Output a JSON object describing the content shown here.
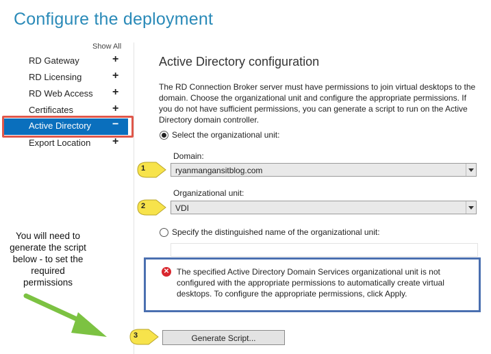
{
  "page": {
    "title": "Configure the deployment"
  },
  "nav": {
    "show_all": "Show All",
    "items": [
      {
        "label": "RD Gateway",
        "sign": "+"
      },
      {
        "label": "RD Licensing",
        "sign": "+"
      },
      {
        "label": "RD Web Access",
        "sign": "+"
      },
      {
        "label": "Certificates",
        "sign": "+"
      },
      {
        "label": "Active Directory",
        "sign": "−",
        "active": true
      },
      {
        "label": "Export Location",
        "sign": "+"
      }
    ]
  },
  "section": {
    "title": "Active Directory configuration",
    "description": "The RD Connection Broker server must have permissions to join virtual desktops to the domain. Choose the organizational unit and configure the appropriate permissions. If you do not have sufficient permissions, you can generate a script to run on the Active Directory domain controller.",
    "radio_ou_label": "Select the organizational unit:",
    "domain_label": "Domain:",
    "domain_value": "ryanmangansitblog.com",
    "ou_label": "Organizational unit:",
    "ou_value": "VDI",
    "radio_dn_label": "Specify the distinguished name of the organizational unit:",
    "dn_value": ""
  },
  "error": {
    "icon": "error-x-icon",
    "message": "The specified Active Directory Domain Services organizational unit is not configured with the appropriate permissions to automatically create virtual desktops. To configure the appropriate permissions, click Apply."
  },
  "buttons": {
    "generate_script": "Generate Script..."
  },
  "annotations": {
    "callout_1": "1",
    "callout_2": "2",
    "callout_3": "3",
    "note": "You will need to generate the script below - to set the required permissions"
  },
  "colors": {
    "title": "#2a8ab8",
    "nav_active": "#0a6fbd",
    "nav_highlight_border": "#e0574a",
    "error_border": "#4a6fb0",
    "error_icon": "#d9272e",
    "callout_fill": "#f7e34b",
    "arrow": "#7cc242"
  }
}
